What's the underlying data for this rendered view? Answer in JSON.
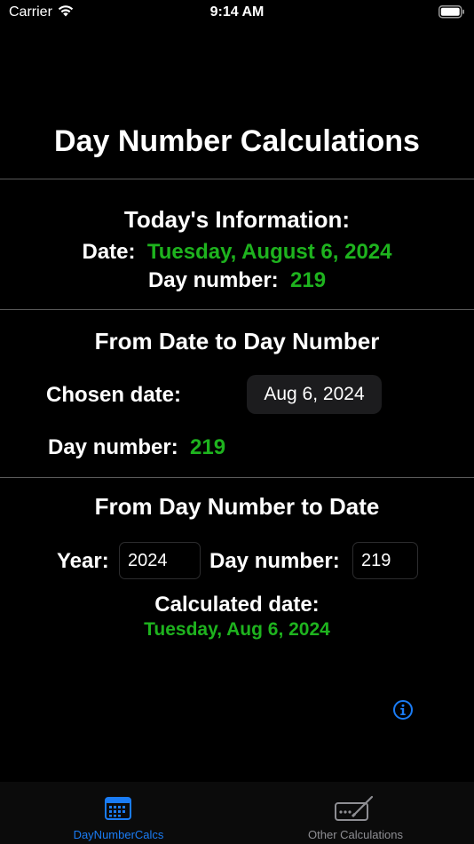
{
  "status_bar": {
    "carrier": "Carrier",
    "time": "9:14 AM"
  },
  "title": "Day Number Calculations",
  "today": {
    "heading": "Today's Information:",
    "date_label": "Date:",
    "date_value": "Tuesday, August 6, 2024",
    "day_label": "Day number:",
    "day_value": "219"
  },
  "date_to_day": {
    "heading": "From Date to Day Number",
    "chosen_label": "Chosen date:",
    "chosen_value": "Aug 6, 2024",
    "day_label": "Day number:",
    "day_value": "219"
  },
  "day_to_date": {
    "heading": "From Day Number to Date",
    "year_label": "Year:",
    "year_value": "2024",
    "day_label": "Day number:",
    "day_value": "219",
    "calc_label": "Calculated date:",
    "calc_value": "Tuesday, Aug 6, 2024"
  },
  "tabs": [
    {
      "label": "DayNumberCalcs",
      "selected": true
    },
    {
      "label": "Other Calculations",
      "selected": false
    }
  ],
  "colors": {
    "accent": "#1a7cf5",
    "result_green": "#1eb31e",
    "tab_inactive": "#8e8e93"
  }
}
